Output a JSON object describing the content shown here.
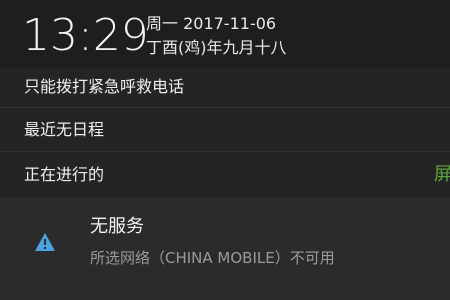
{
  "status": {
    "time": "13:29",
    "date": "周一 2017-11-06",
    "lunar": "丁酉(鸡)年九月十八"
  },
  "rows": {
    "emergency": "只能拨打紧急呼救电话",
    "schedule": "最近无日程",
    "ongoing": "正在进行的",
    "ongoing_trail": "屏"
  },
  "notification": {
    "icon": "warning-triangle-icon",
    "title": "无服务",
    "subtitle": "所选网络（CHINA MOBILE）不可用"
  },
  "colors": {
    "accent_green": "#5aa83a",
    "warning_blue": "#4aa3df"
  }
}
